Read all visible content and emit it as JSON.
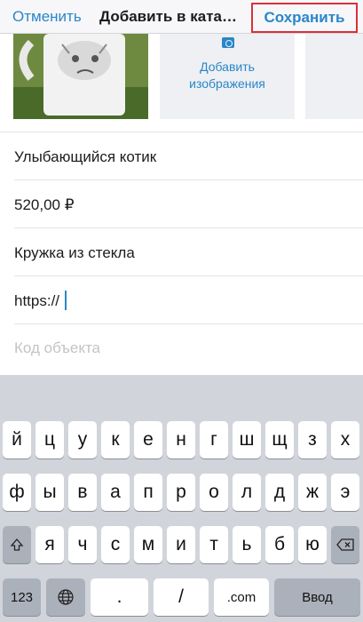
{
  "header": {
    "cancel_label": "Отменить",
    "title": "Добавить в ката…",
    "save_label": "Сохранить"
  },
  "images": {
    "add_label_line1": "Добавить",
    "add_label_line2": "изображения"
  },
  "form": {
    "name_value": "Улыбающийся котик",
    "price_value": "520,00 ₽",
    "description_value": "Кружка из стекла",
    "url_value": "https://",
    "code_placeholder": "Код объекта"
  },
  "keyboard": {
    "row1": [
      "й",
      "ц",
      "у",
      "к",
      "е",
      "н",
      "г",
      "ш",
      "щ",
      "з",
      "х"
    ],
    "row2": [
      "ф",
      "ы",
      "в",
      "а",
      "п",
      "р",
      "о",
      "л",
      "д",
      "ж",
      "э"
    ],
    "row3": [
      "я",
      "ч",
      "с",
      "м",
      "и",
      "т",
      "ь",
      "б",
      "ю"
    ],
    "numbers_label": "123",
    "dot_label": ".",
    "slash_label": "/",
    "com_label": ".com",
    "enter_label": "Ввод"
  },
  "colors": {
    "accent": "#2a86c9",
    "highlight_border": "#d9303a",
    "keyboard_bg": "#d1d5db"
  }
}
